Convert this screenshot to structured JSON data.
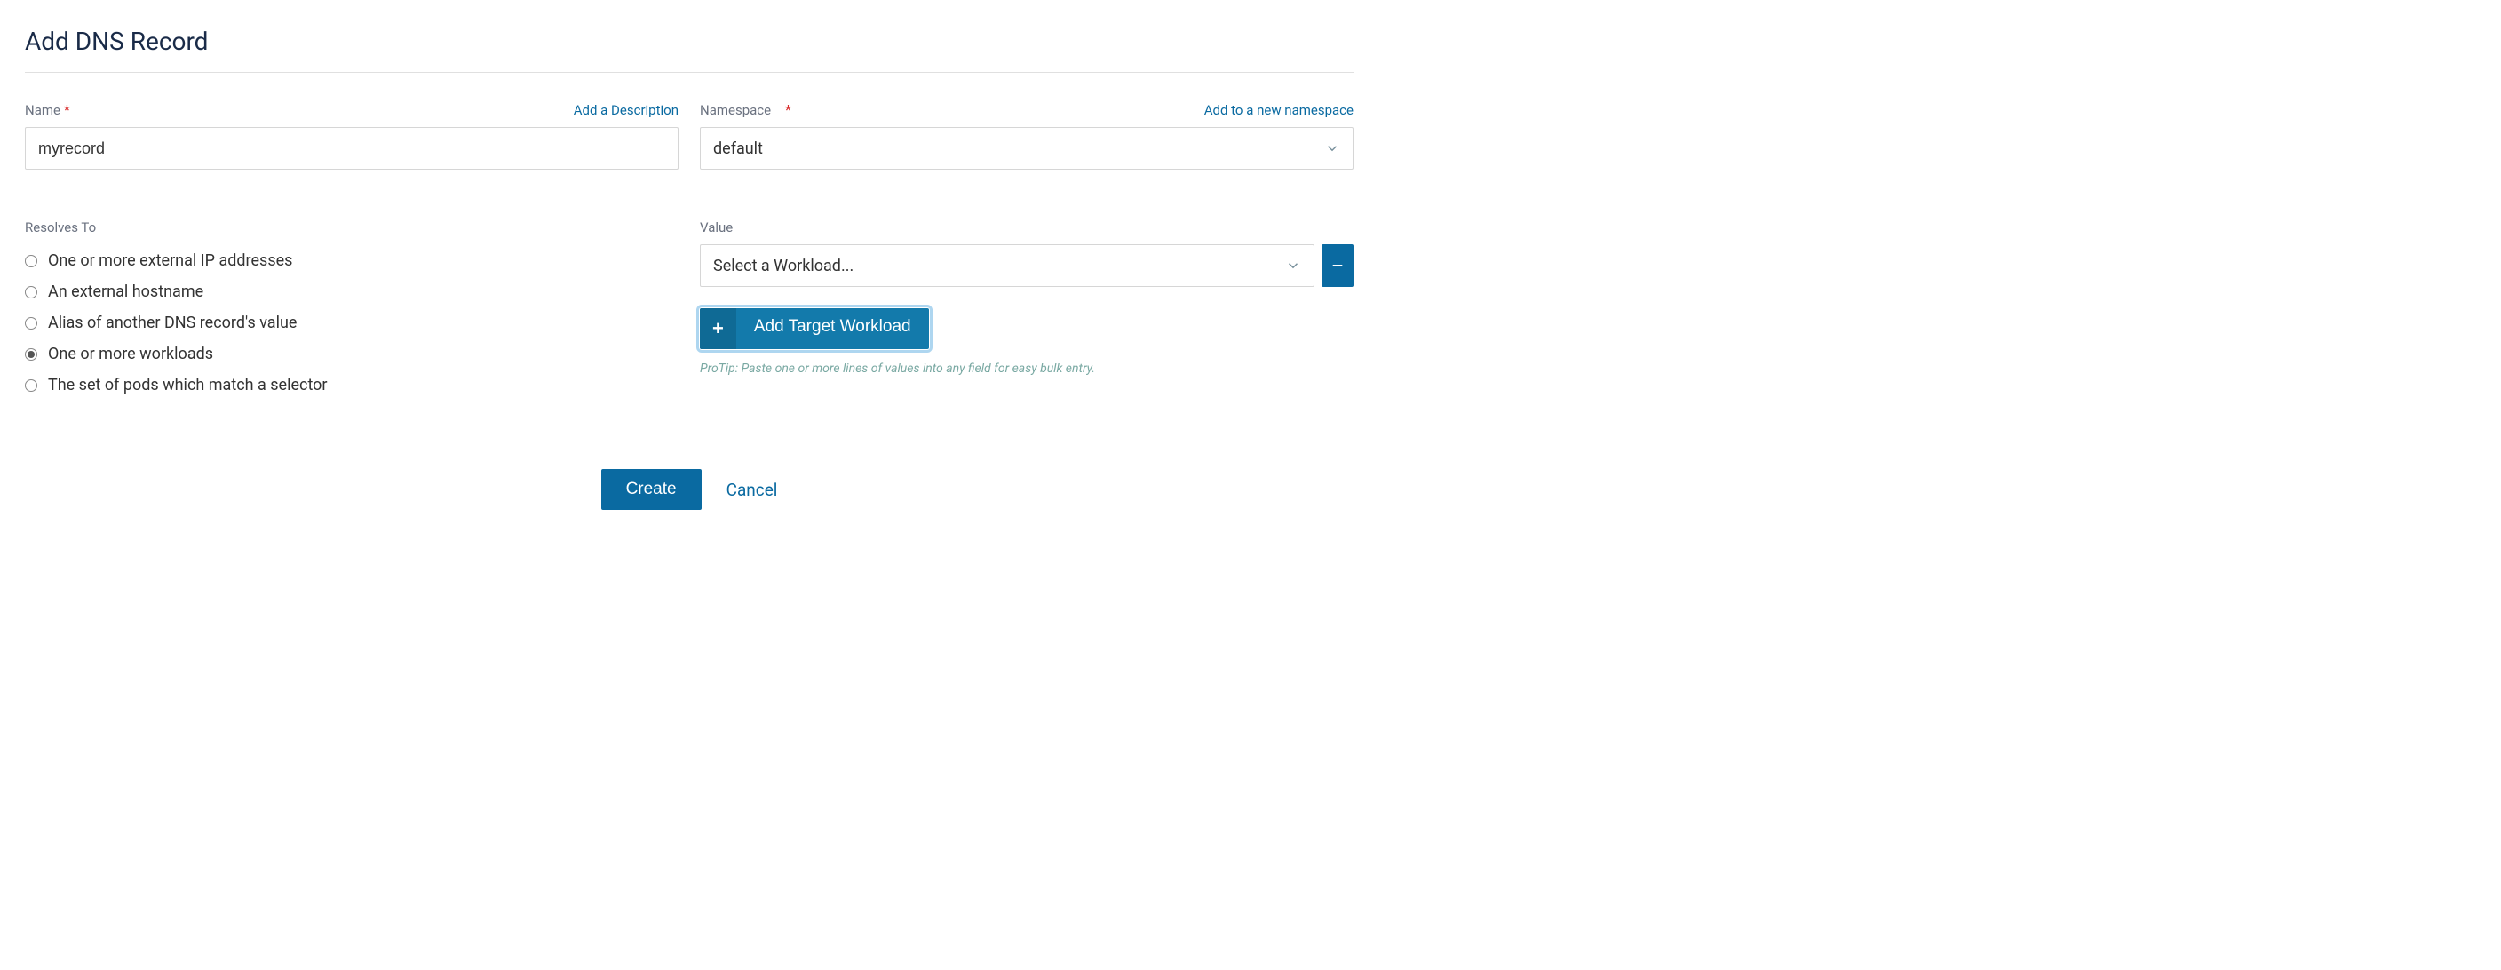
{
  "page_title": "Add DNS Record",
  "name_field": {
    "label": "Name",
    "value": "myrecord",
    "link": "Add a Description"
  },
  "namespace_field": {
    "label": "Namespace",
    "selected": "default",
    "link": "Add to a new namespace"
  },
  "resolves_to": {
    "heading": "Resolves To",
    "options": [
      {
        "label": "One or more external IP addresses",
        "checked": false
      },
      {
        "label": "An external hostname",
        "checked": false
      },
      {
        "label": "Alias of another DNS record's value",
        "checked": false
      },
      {
        "label": "One or more workloads",
        "checked": true
      },
      {
        "label": "The set of pods which match a selector",
        "checked": false
      }
    ]
  },
  "value_section": {
    "label": "Value",
    "select_placeholder": "Select a Workload...",
    "add_button": "Add Target Workload",
    "protip": "ProTip: Paste one or more lines of values into any field for easy bulk entry."
  },
  "actions": {
    "create": "Create",
    "cancel": "Cancel"
  }
}
